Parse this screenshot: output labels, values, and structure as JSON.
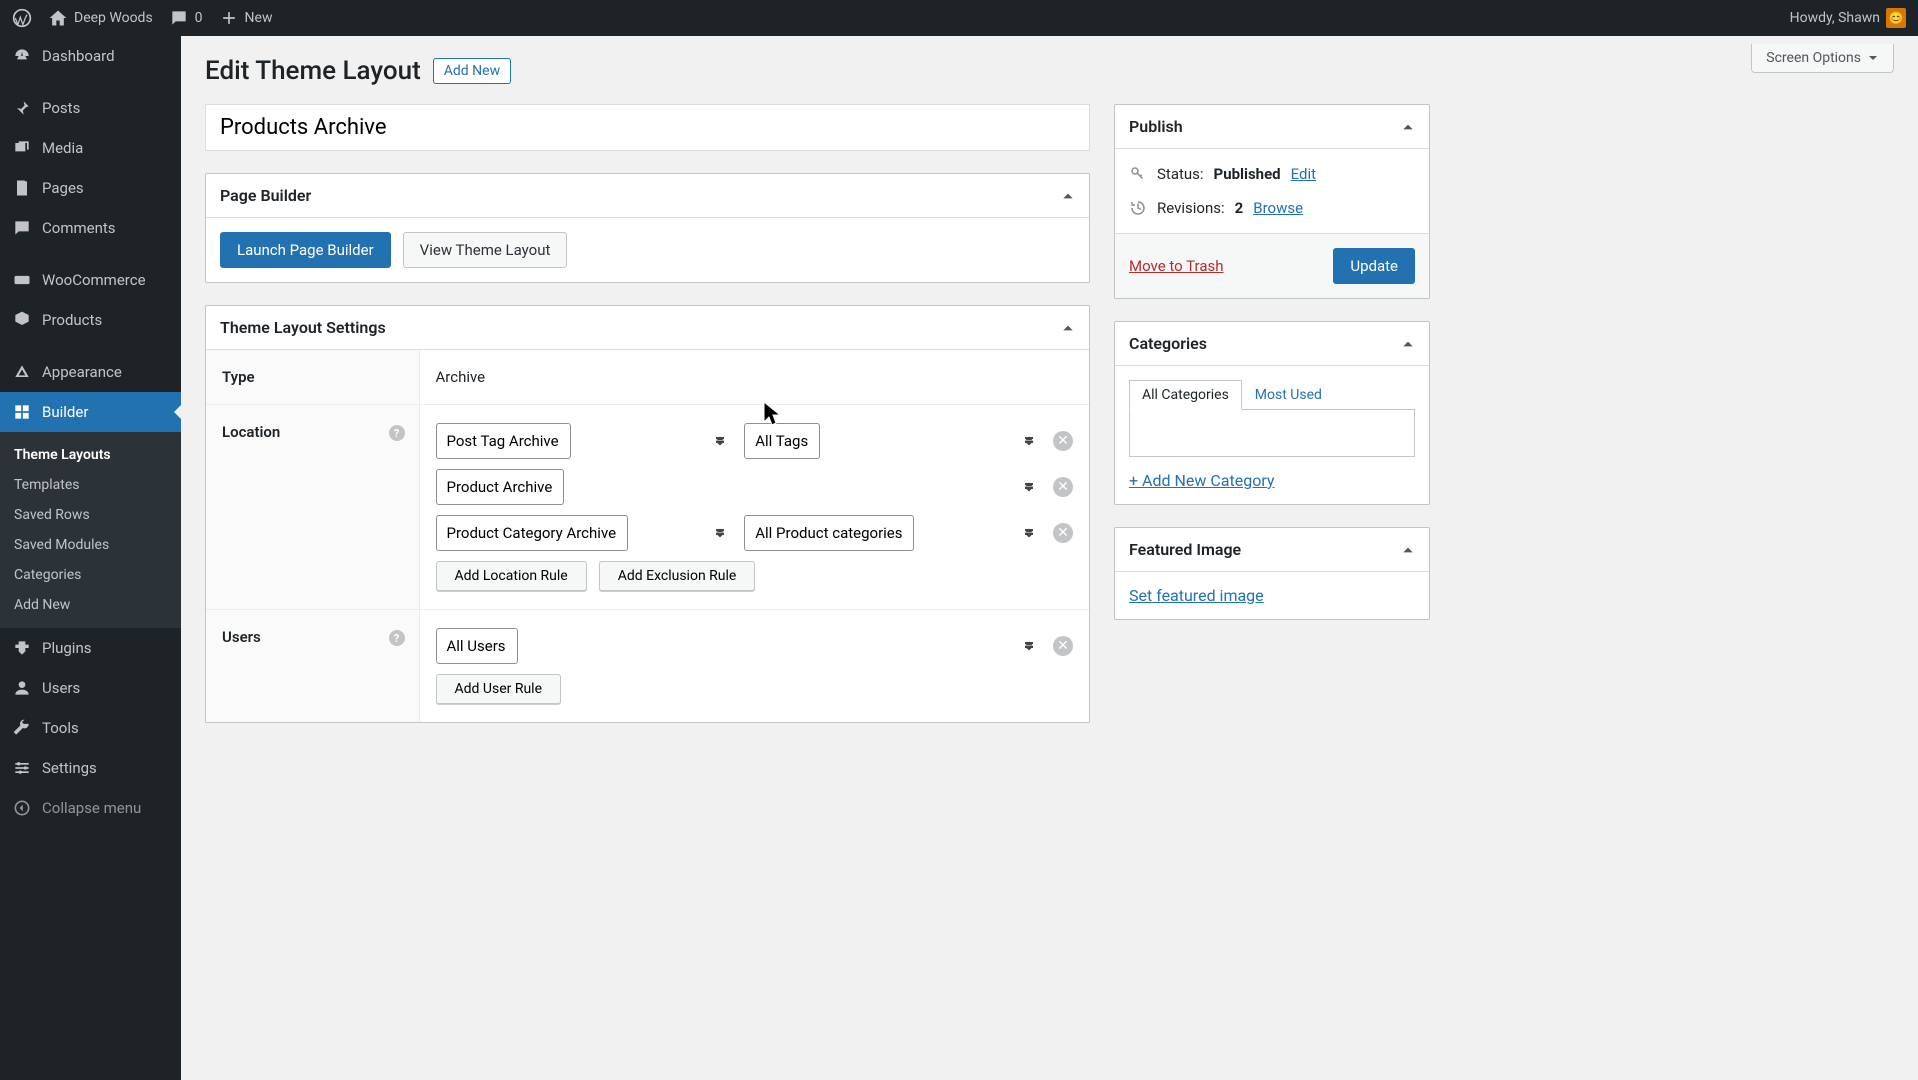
{
  "adminBar": {
    "siteName": "Deep Woods",
    "commentsCount": "0",
    "newLabel": "New",
    "howdy": "Howdy, Shawn"
  },
  "sidebar": {
    "dashboard": "Dashboard",
    "posts": "Posts",
    "media": "Media",
    "pages": "Pages",
    "comments": "Comments",
    "woocommerce": "WooCommerce",
    "products": "Products",
    "appearance": "Appearance",
    "builder": "Builder",
    "plugins": "Plugins",
    "users": "Users",
    "tools": "Tools",
    "settings": "Settings",
    "collapse": "Collapse menu",
    "sub": {
      "themeLayouts": "Theme Layouts",
      "templates": "Templates",
      "savedRows": "Saved Rows",
      "savedModules": "Saved Modules",
      "categories": "Categories",
      "addNew": "Add New"
    }
  },
  "page": {
    "title": "Edit Theme Layout",
    "addNewBtn": "Add New",
    "postTitle": "Products Archive",
    "screenOptions": "Screen Options"
  },
  "pageBuilder": {
    "title": "Page Builder",
    "launch": "Launch Page Builder",
    "view": "View Theme Layout"
  },
  "settings": {
    "title": "Theme Layout Settings",
    "typeLabel": "Type",
    "typeValue": "Archive",
    "locationLabel": "Location",
    "usersLabel": "Users",
    "rules": {
      "r1a": "Post Tag Archive",
      "r1b": "All Tags",
      "r2": "Product Archive",
      "r3a": "Product Category Archive",
      "r3b": "All Product categories",
      "addLocation": "Add Location Rule",
      "addExclusion": "Add Exclusion Rule",
      "allUsers": "All Users",
      "addUser": "Add User Rule"
    }
  },
  "publish": {
    "title": "Publish",
    "statusLabel": "Status:",
    "statusValue": "Published",
    "edit": "Edit",
    "revisionsLabel": "Revisions:",
    "revisionsCount": "2",
    "browse": "Browse",
    "trash": "Move to Trash",
    "update": "Update"
  },
  "categories": {
    "title": "Categories",
    "allTab": "All Categories",
    "mostUsedTab": "Most Used",
    "addNew": "+ Add New Category"
  },
  "featuredImage": {
    "title": "Featured Image",
    "set": "Set featured image"
  }
}
